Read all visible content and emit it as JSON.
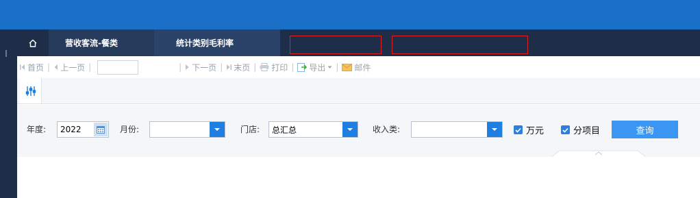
{
  "tabs": [
    {
      "label": "营收客流-餐类"
    },
    {
      "label": "统计类别毛利率"
    }
  ],
  "toolbar": {
    "first": "首页",
    "prev": "上一页",
    "next": "下一页",
    "last": "末页",
    "print": "打印",
    "export": "导出",
    "mail": "邮件"
  },
  "filters": {
    "year_label": "年度:",
    "year_value": "2022",
    "month_label": "月份:",
    "month_value": "",
    "store_label": "门店:",
    "store_value": "总汇总",
    "income_label": "收入类:",
    "income_value": "",
    "wan_label": "万元",
    "wan_checked": true,
    "item_label": "分项目",
    "item_checked": true,
    "query_label": "查询"
  },
  "colors": {
    "topbar": "#1a6fc7",
    "navbar": "#1e2d48",
    "accent": "#1e7fe0",
    "query_button": "#3a96f0",
    "annotation_box": "#e02020"
  },
  "icons": [
    "home-icon",
    "first-page-icon",
    "prev-page-icon",
    "next-page-icon",
    "last-page-icon",
    "print-icon",
    "export-icon",
    "mail-icon",
    "filter-settings-icon",
    "calendar-icon",
    "dropdown-icon",
    "checkbox-icon"
  ]
}
